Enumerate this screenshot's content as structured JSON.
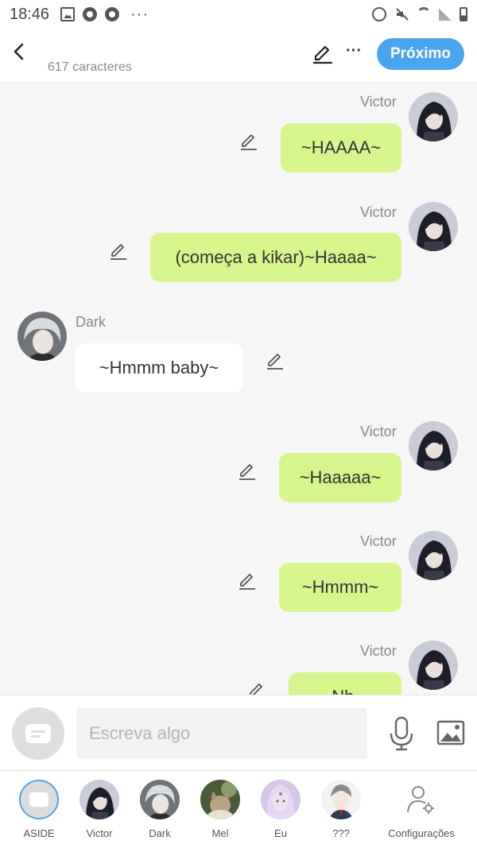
{
  "status_bar": {
    "time": "18:46",
    "more": "···"
  },
  "header": {
    "char_count": "617 caracteres",
    "next_label": "Próximo",
    "more_label": "···"
  },
  "messages": [
    {
      "sender": "Victor",
      "text": "~HAAAA~",
      "side": "right"
    },
    {
      "sender": "Victor",
      "text": "(começa a kikar)~Haaaa~",
      "side": "right"
    },
    {
      "sender": "Dark",
      "text": "~Hmmm baby~",
      "side": "left"
    },
    {
      "sender": "Victor",
      "text": "~Haaaaa~",
      "side": "right"
    },
    {
      "sender": "Victor",
      "text": "~Hmmm~",
      "side": "right"
    },
    {
      "sender": "Victor",
      "text": "~Nh...",
      "side": "right"
    }
  ],
  "input": {
    "placeholder": "Escreva algo"
  },
  "characters": [
    {
      "label": "ASIDE"
    },
    {
      "label": "Victor"
    },
    {
      "label": "Dark"
    },
    {
      "label": "Mel"
    },
    {
      "label": "Eu"
    },
    {
      "label": "???"
    },
    {
      "label": "Configurações"
    }
  ],
  "colors": {
    "accent": "#4aa5f0",
    "my_bubble": "#d7f58d",
    "other_bubble": "#ffffff",
    "background": "#f6f6f6"
  }
}
